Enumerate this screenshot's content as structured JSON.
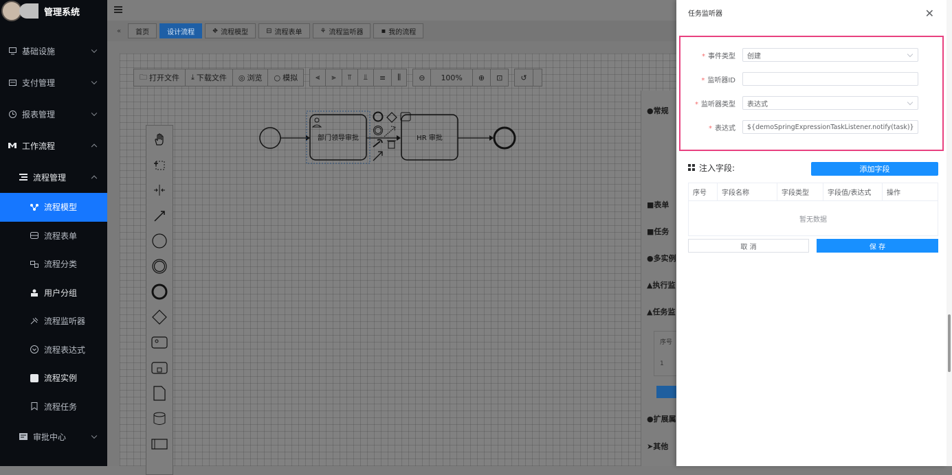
{
  "app": {
    "title": "管理系统"
  },
  "sidebar": {
    "items": [
      {
        "label": "基础设施",
        "icon": "monitor-icon",
        "level": "top",
        "arrow": "down"
      },
      {
        "label": "支付管理",
        "icon": "card-icon",
        "level": "top",
        "arrow": "down"
      },
      {
        "label": "报表管理",
        "icon": "clock-icon",
        "level": "top",
        "arrow": "down"
      },
      {
        "label": "工作流程",
        "icon": "workflow-icon",
        "level": "top",
        "arrow": "up"
      },
      {
        "label": "流程管理",
        "icon": "list-icon",
        "level": "sub",
        "arrow": "up"
      },
      {
        "label": "流程模型",
        "icon": "model-icon",
        "level": "leaf",
        "active": true
      },
      {
        "label": "流程表单",
        "icon": "form-icon",
        "level": "leaf"
      },
      {
        "label": "流程分类",
        "icon": "category-icon",
        "level": "leaf"
      },
      {
        "label": "用户分组",
        "icon": "group-icon",
        "level": "leaf"
      },
      {
        "label": "流程监听器",
        "icon": "listener-icon",
        "level": "leaf"
      },
      {
        "label": "流程表达式",
        "icon": "expression-icon",
        "level": "leaf"
      },
      {
        "label": "流程实例",
        "icon": "instance-icon",
        "level": "leaf"
      },
      {
        "label": "流程任务",
        "icon": "task-icon",
        "level": "leaf"
      },
      {
        "label": "审批中心",
        "icon": "approval-icon",
        "level": "sub",
        "arrow": "down"
      }
    ]
  },
  "tabs": [
    {
      "label": "首页"
    },
    {
      "label": "设计流程",
      "active": true
    },
    {
      "label": "流程模型",
      "icon": "model-icon"
    },
    {
      "label": "流程表单",
      "icon": "form-icon"
    },
    {
      "label": "流程监听器",
      "icon": "listener-icon"
    },
    {
      "label": "我的流程",
      "icon": "book-icon"
    }
  ],
  "toolbar": {
    "open_file": "打开文件",
    "download_file": "下载文件",
    "browse": "浏览",
    "simulate": "模拟",
    "zoom": "100%"
  },
  "diagram": {
    "task1": "部门领导审批",
    "task2": "HR 审批"
  },
  "props_panel": {
    "items": [
      "常规",
      "表单",
      "任务",
      "多实例",
      "执行监",
      "任务监",
      "扩展属",
      "其他"
    ],
    "mini_table": {
      "header": "序号",
      "row": "1"
    }
  },
  "drawer": {
    "title": "任务监听器",
    "form": {
      "event_type": {
        "label": "事件类型",
        "value": "创建"
      },
      "listener_id": {
        "label": "监听器ID",
        "value": ""
      },
      "listener_type": {
        "label": "监听器类型",
        "value": "表达式"
      },
      "expression": {
        "label": "表达式",
        "value": "${demoSpringExpressionTaskListener.notify(task)}"
      }
    },
    "inject_fields": {
      "title": "注入字段:",
      "add_button": "添加字段",
      "columns": [
        "序号",
        "字段名称",
        "字段类型",
        "字段值/表达式",
        "操作"
      ],
      "empty_text": "暂无数据"
    },
    "cancel": "取 消",
    "save": "保 存"
  },
  "colors": {
    "primary": "#1890ff",
    "sidebar_bg": "#0a0d12",
    "highlight_border": "#e8407f",
    "required": "#f56c6c"
  }
}
